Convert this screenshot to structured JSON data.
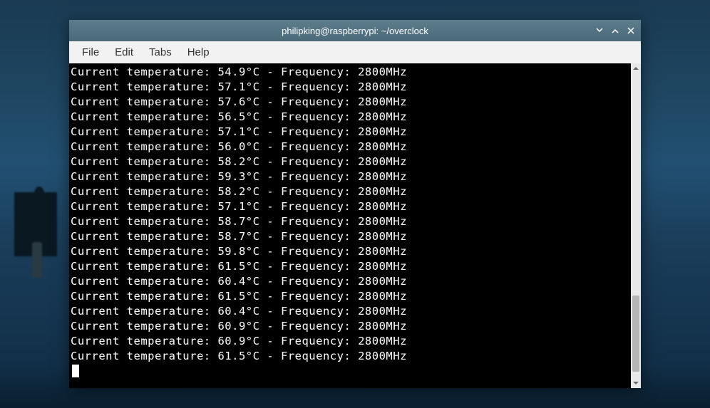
{
  "window": {
    "title": "philipking@raspberrypi: ~/overclock"
  },
  "menubar": {
    "file": "File",
    "edit": "Edit",
    "tabs": "Tabs",
    "help": "Help"
  },
  "terminal": {
    "line_prefix": "Current temperature: ",
    "line_mid": " - Frequency: ",
    "readings": [
      {
        "temp": "54.9°C",
        "freq": "2800MHz"
      },
      {
        "temp": "57.1°C",
        "freq": "2800MHz"
      },
      {
        "temp": "57.6°C",
        "freq": "2800MHz"
      },
      {
        "temp": "56.5°C",
        "freq": "2800MHz"
      },
      {
        "temp": "57.1°C",
        "freq": "2800MHz"
      },
      {
        "temp": "56.0°C",
        "freq": "2800MHz"
      },
      {
        "temp": "58.2°C",
        "freq": "2800MHz"
      },
      {
        "temp": "59.3°C",
        "freq": "2800MHz"
      },
      {
        "temp": "58.2°C",
        "freq": "2800MHz"
      },
      {
        "temp": "57.1°C",
        "freq": "2800MHz"
      },
      {
        "temp": "58.7°C",
        "freq": "2800MHz"
      },
      {
        "temp": "58.7°C",
        "freq": "2800MHz"
      },
      {
        "temp": "59.8°C",
        "freq": "2800MHz"
      },
      {
        "temp": "61.5°C",
        "freq": "2800MHz"
      },
      {
        "temp": "60.4°C",
        "freq": "2800MHz"
      },
      {
        "temp": "61.5°C",
        "freq": "2800MHz"
      },
      {
        "temp": "60.4°C",
        "freq": "2800MHz"
      },
      {
        "temp": "60.9°C",
        "freq": "2800MHz"
      },
      {
        "temp": "60.9°C",
        "freq": "2800MHz"
      },
      {
        "temp": "61.5°C",
        "freq": "2800MHz"
      }
    ]
  },
  "scrollbar": {
    "thumb_top_pct": 73,
    "thumb_height_pct": 25
  }
}
